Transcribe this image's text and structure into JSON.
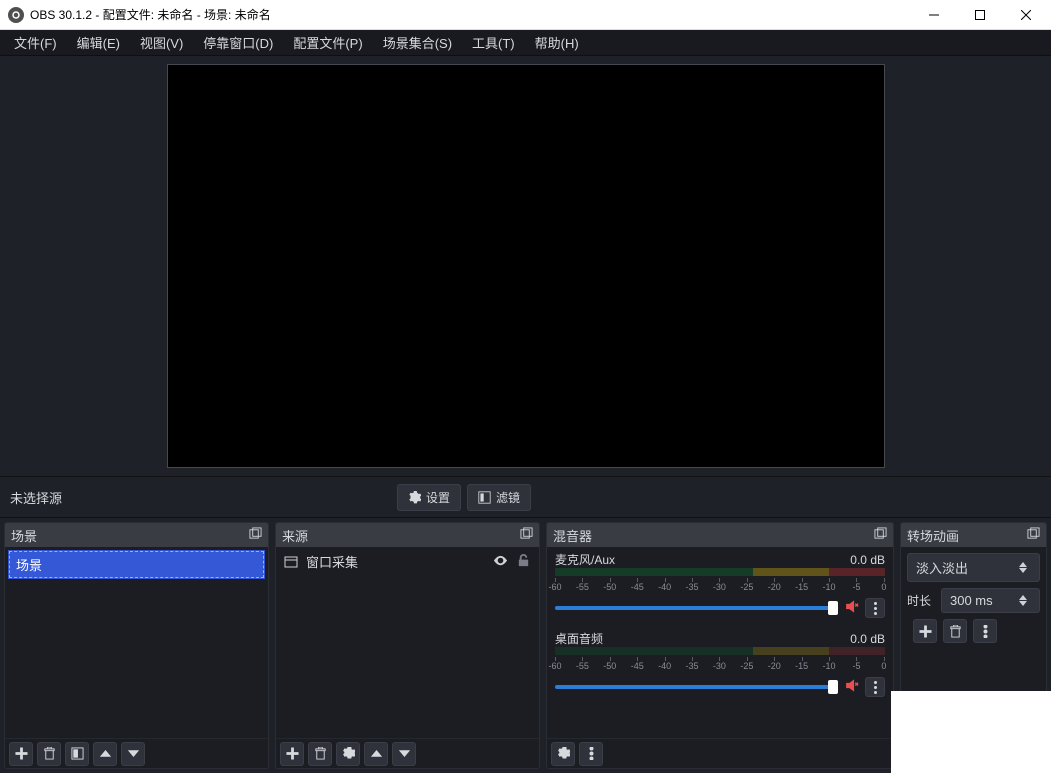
{
  "titlebar": {
    "title": "OBS 30.1.2 - 配置文件: 未命名 - 场景: 未命名"
  },
  "menu": {
    "file": "文件(F)",
    "edit": "编辑(E)",
    "view": "视图(V)",
    "docks": "停靠窗口(D)",
    "profile": "配置文件(P)",
    "scenecol": "场景集合(S)",
    "tools": "工具(T)",
    "help": "帮助(H)"
  },
  "midbar": {
    "nosource": "未选择源",
    "properties": "设置",
    "filters": "滤镜"
  },
  "docks": {
    "scenes": {
      "title": "场景",
      "items": [
        "场景"
      ]
    },
    "sources": {
      "title": "来源",
      "items": [
        {
          "icon": "window",
          "label": "窗口采集"
        }
      ]
    },
    "mixer": {
      "title": "混音器",
      "channels": [
        {
          "name": "麦克风/Aux",
          "db": "0.0 dB"
        },
        {
          "name": "桌面音频",
          "db": "0.0 dB"
        }
      ],
      "ticks": [
        "-60",
        "-55",
        "-50",
        "-45",
        "-40",
        "-35",
        "-30",
        "-25",
        "-20",
        "-15",
        "-10",
        "-5",
        "0"
      ]
    },
    "trans": {
      "title": "转场动画",
      "type": "淡入淡出",
      "dur_label": "时长",
      "duration": "300 ms"
    }
  }
}
